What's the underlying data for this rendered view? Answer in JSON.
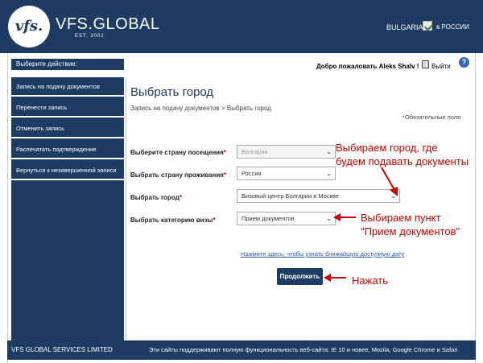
{
  "header": {
    "logo_mark": "vfs.",
    "logo_text": "VFS.GLOBAL",
    "logo_est": "EST. 2001",
    "country": "BULGARIA",
    "country_link": "в РОССИИ"
  },
  "top": {
    "action_label": "Выберите действие:",
    "welcome": "Добро пожаловать Aleks Shalv !",
    "exit": "Выйти",
    "help": "?"
  },
  "sidebar": {
    "items": [
      {
        "label": "Запись на подачу документов"
      },
      {
        "label": "Перенести запись"
      },
      {
        "label": "Отменить запись"
      },
      {
        "label": "Распечатать подтверждение"
      },
      {
        "label": "Вернуться к незавершенной записи"
      }
    ]
  },
  "main": {
    "title": "Выбрать город",
    "breadcrumb": "Запись на подачу документов  >  Выбрать город",
    "required_note": "*Обязательные поля",
    "fields": [
      {
        "label": "Выберите страну посещения",
        "value": "Болгария"
      },
      {
        "label": "Выбрать страну проживания",
        "value": "Россия"
      },
      {
        "label": "Выбрать город",
        "value": "Визовый центр Болгарии в Москве"
      },
      {
        "label": "Выбрать категорию визы",
        "value": "Прием документов"
      }
    ],
    "star": "*",
    "link": "Нажмите здесь, чтобы узнать ближайшую доступную дату",
    "continue": "Продолжить"
  },
  "annotations": {
    "city": "Выбираем город, где будем подавать документы",
    "city_line1": "Выбираем город, где",
    "city_line2": "будем подавать документы",
    "visa_line1": "Выбираем пункт",
    "visa_line2": "\"Прием документов\"",
    "press": "Нажать",
    "color": "#cc0000"
  },
  "footer": {
    "left": "VFS GLOBAL SERVICES LIMITED",
    "right": "Эти сайты поддерживают полную функциональность веб-сайта: IE 10 и новее, Mozila, Google Chrome и Safari"
  }
}
